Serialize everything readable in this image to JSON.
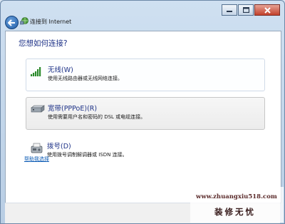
{
  "window": {
    "title": "连接到 Internet"
  },
  "main": {
    "heading": "您想如何连接?",
    "options": [
      {
        "title": "无线(W)",
        "description": "使用无线路由器或无线网络连接。",
        "icon": "wireless-signal-icon"
      },
      {
        "title": "宽带(PPPoE)(R)",
        "description": "使用需要用户名和密码的 DSL 或电缆连接。",
        "icon": "broadband-modem-icon"
      },
      {
        "title": "拨号(D)",
        "description": "使用拨号调制解调器或 ISDN 连接。",
        "icon": "dialup-fax-icon"
      }
    ],
    "help_link": "帮助我选择"
  },
  "watermark": {
    "url": "www.zhuangxiu518.com",
    "logo_text": "装修无忧"
  },
  "colors": {
    "heading": "#1e3287",
    "link": "#0b5ab4",
    "frame": "#b8cde4"
  }
}
